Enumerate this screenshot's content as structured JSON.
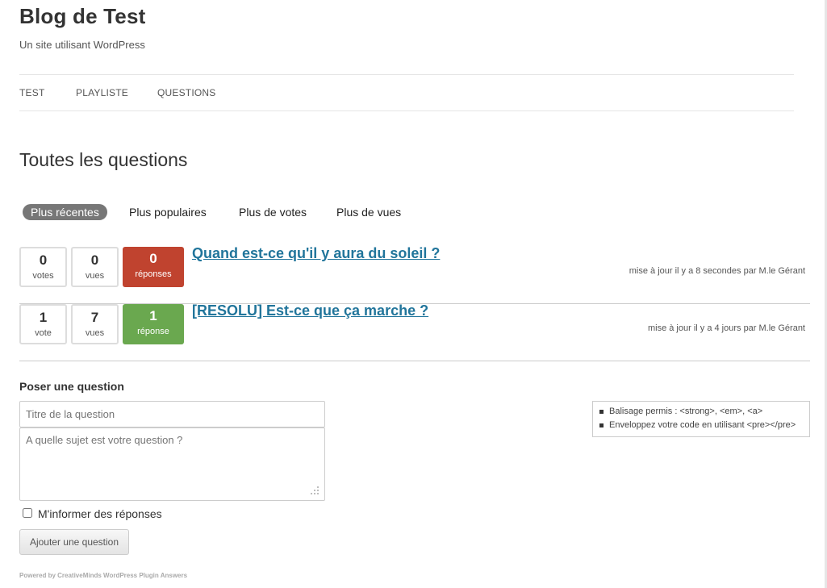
{
  "site": {
    "title": "Blog de Test",
    "description": "Un site utilisant WordPress"
  },
  "nav": {
    "items": [
      "TEST",
      "PLAYLISTE",
      "QUESTIONS"
    ]
  },
  "page": {
    "title": "Toutes les questions"
  },
  "sort_tabs": {
    "items": [
      "Plus récentes",
      "Plus populaires",
      "Plus de votes",
      "Plus de vues"
    ],
    "active": "Plus récentes"
  },
  "questions": [
    {
      "votes": "0",
      "votes_label": "votes",
      "views": "0",
      "views_label": "vues",
      "answers": "0",
      "answers_label": "réponses",
      "answers_color": "#c0432f",
      "title": "Quand est-ce qu'il y aura du soleil ?",
      "meta": "mise à jour il y a 8 secondes par M.le Gérant"
    },
    {
      "votes": "1",
      "votes_label": "vote",
      "views": "7",
      "views_label": "vues",
      "answers": "1",
      "answers_label": "réponse",
      "answers_color": "#6aa84f",
      "title": "[RESOLU] Est-ce que ça marche ?",
      "meta": "mise à jour il y a 4 jours par M.le Gérant"
    }
  ],
  "ask_form": {
    "heading": "Poser une question",
    "title_placeholder": "Titre de la question",
    "body_placeholder": "A quelle sujet est votre question ?",
    "notify_label": "M'informer des réponses",
    "notify_checked": false,
    "submit_label": "Ajouter une question"
  },
  "hints": [
    "Balisage permis : <strong>, <em>, <a>",
    "Enveloppez votre code en utilisant <pre></pre>"
  ],
  "footer": {
    "powered_by": "Powered by CreativeMinds WordPress Plugin Answers"
  },
  "colors": {
    "link": "#21759b",
    "answers_zero": "#c0432f",
    "answers_positive": "#6aa84f",
    "active_tab": "#777777"
  }
}
